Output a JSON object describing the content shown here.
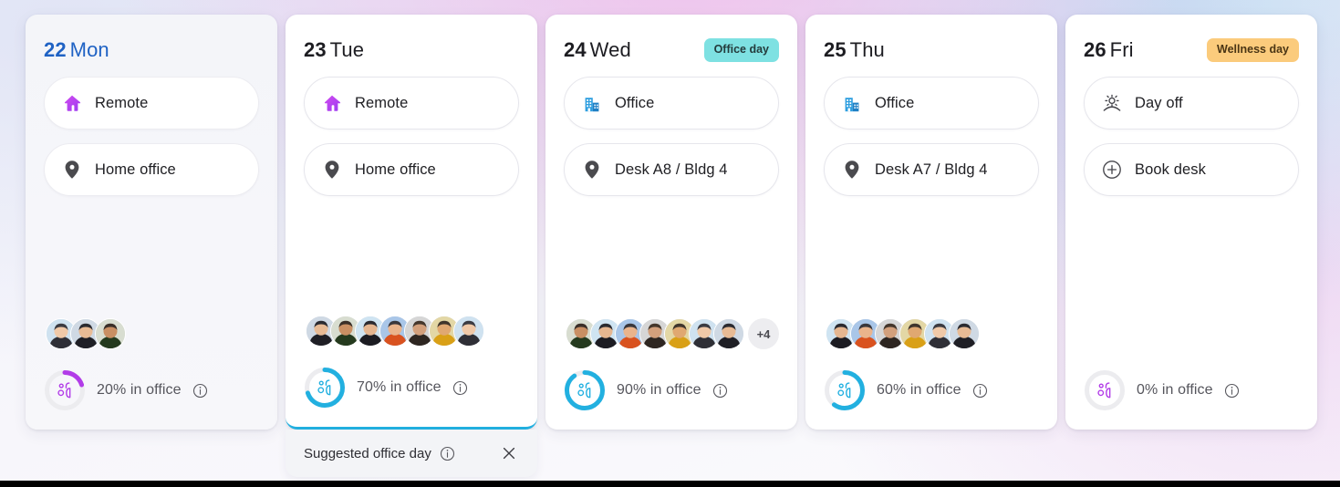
{
  "theme": {
    "accent_blue": "#1f62c4",
    "office_badge_bg": "#7ee1e2",
    "wellness_badge_bg": "#fbcb7c",
    "donut_blue": "#22b0e0",
    "donut_purple": "#b23ce8",
    "donut_track": "#ececef",
    "card_bg": "#ffffff",
    "today_card_bg": "#f5f6f9"
  },
  "days": [
    {
      "date_number": "22",
      "day_of_week": "Mon",
      "is_today": true,
      "badge": null,
      "badge_kind": null,
      "rows": [
        {
          "icon": "home-icon",
          "label": "Remote"
        },
        {
          "icon": "location-pin-icon",
          "label": "Home office"
        }
      ],
      "avatar_count": 3,
      "overflow_label": null,
      "percent": 20,
      "percent_label": "20% in office",
      "ring_color": "#b23ce8",
      "glyph_color": "#b23ce8",
      "banner": null
    },
    {
      "date_number": "23",
      "day_of_week": "Tue",
      "is_today": false,
      "badge": null,
      "badge_kind": null,
      "rows": [
        {
          "icon": "home-icon",
          "label": "Remote"
        },
        {
          "icon": "location-pin-icon",
          "label": "Home office"
        }
      ],
      "avatar_count": 7,
      "overflow_label": null,
      "percent": 70,
      "percent_label": "70% in office",
      "ring_color": "#22b0e0",
      "glyph_color": "#22b0e0",
      "banner": {
        "label": "Suggested office day",
        "close_label": "×"
      }
    },
    {
      "date_number": "24",
      "day_of_week": "Wed",
      "is_today": false,
      "badge": "Office day",
      "badge_kind": "office",
      "rows": [
        {
          "icon": "office-building-icon",
          "label": "Office"
        },
        {
          "icon": "location-pin-icon",
          "label": "Desk A8 / Bldg 4"
        }
      ],
      "avatar_count": 7,
      "overflow_label": "+4",
      "percent": 90,
      "percent_label": "90% in office",
      "ring_color": "#22b0e0",
      "glyph_color": "#22b0e0",
      "banner": null
    },
    {
      "date_number": "25",
      "day_of_week": "Thu",
      "is_today": false,
      "badge": null,
      "badge_kind": null,
      "rows": [
        {
          "icon": "office-building-icon",
          "label": "Office"
        },
        {
          "icon": "location-pin-icon",
          "label": "Desk A7 / Bldg 4"
        }
      ],
      "avatar_count": 6,
      "overflow_label": null,
      "percent": 60,
      "percent_label": "60% in office",
      "ring_color": "#22b0e0",
      "glyph_color": "#22b0e0",
      "banner": null
    },
    {
      "date_number": "26",
      "day_of_week": "Fri",
      "is_today": false,
      "badge": "Wellness day",
      "badge_kind": "wellness",
      "rows": [
        {
          "icon": "sunrise-icon",
          "label": "Day off"
        },
        {
          "icon": "plus-circle-icon",
          "label": "Book desk"
        }
      ],
      "avatar_count": 0,
      "overflow_label": null,
      "percent": 0,
      "percent_label": "0% in office",
      "ring_color": "#b23ce8",
      "glyph_color": "#b23ce8",
      "banner": null
    }
  ]
}
